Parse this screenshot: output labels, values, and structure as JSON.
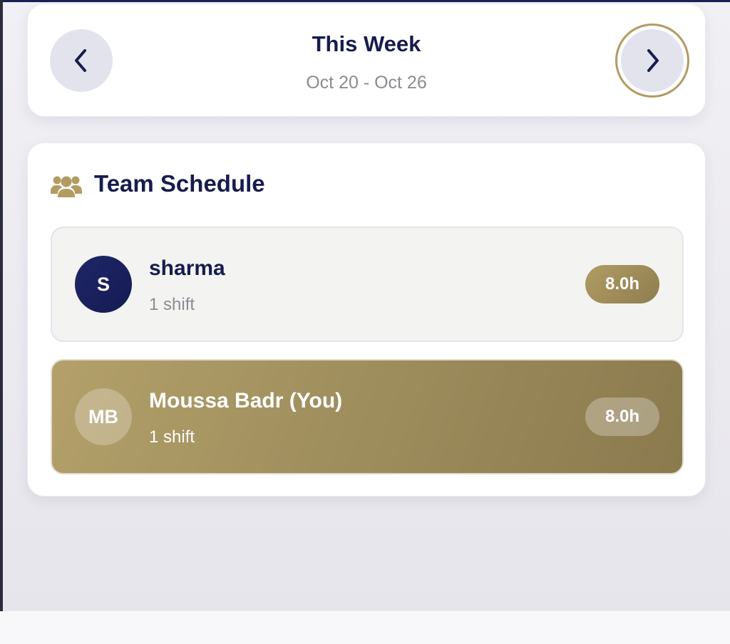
{
  "week_nav": {
    "title": "This Week",
    "range": "Oct 20 - Oct 26",
    "prev_icon": "chevron-left-icon",
    "next_icon": "chevron-right-icon"
  },
  "team_schedule": {
    "title": "Team Schedule",
    "icon": "users-icon",
    "members": [
      {
        "initials": "S",
        "name": "sharma",
        "shifts": "1 shift",
        "hours": "8.0h"
      },
      {
        "initials": "MB",
        "name": "Moussa Badr (You)",
        "shifts": "1 shift",
        "hours": "8.0h"
      }
    ]
  },
  "colors": {
    "navy": "#171c4d",
    "gold": "#b39b62",
    "muted": "#8b8b92"
  }
}
